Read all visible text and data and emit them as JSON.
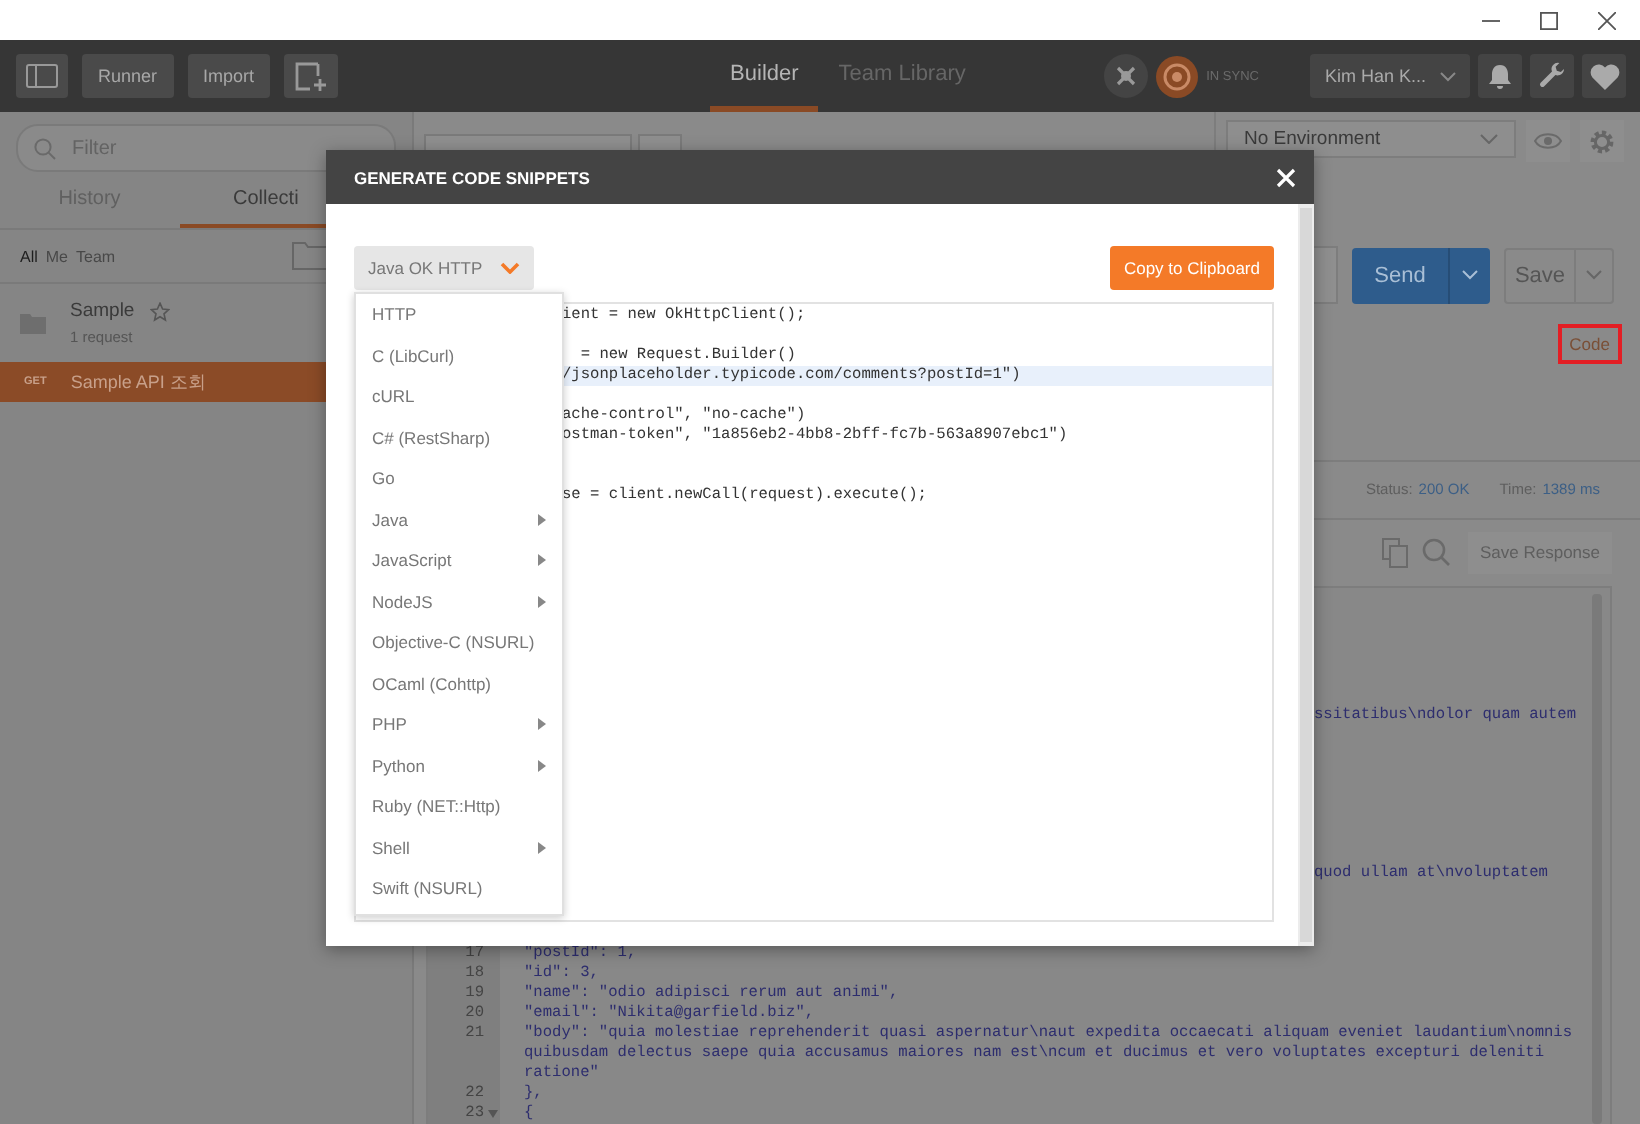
{
  "toolbar": {
    "buttons": [
      "Runner",
      "Import"
    ],
    "tabs": [
      {
        "label": "Builder",
        "selected": true
      },
      {
        "label": "Team Library",
        "selected": false
      }
    ],
    "sync_status": "IN SYNC",
    "user": "Kim Han K..."
  },
  "sidebar": {
    "search": {
      "placeholder": "Filter"
    },
    "tabs": [
      {
        "label": "History",
        "selected": false
      },
      {
        "label": "Collecti",
        "selected": true
      }
    ],
    "filters": [
      {
        "label": "All",
        "selected": true
      },
      {
        "label": "Me",
        "selected": false
      },
      {
        "label": "Team",
        "selected": false
      }
    ],
    "collections": [
      {
        "name": "Sample",
        "count": "1 request"
      }
    ],
    "requests": [
      {
        "method": "GET",
        "name": "Sample API 조회",
        "selected": true
      }
    ]
  },
  "environment": {
    "value": "No Environment"
  },
  "request": {
    "send": "Send",
    "save": "Save",
    "code_link": {
      "label": "Code",
      "highlighted": true
    }
  },
  "response": {
    "status_label": "Status:",
    "status": "200 OK",
    "time_label": "Time:",
    "time": "1389 ms",
    "save_button": "Save Response",
    "fragments": [
      "ssitatibus\\ndolor quam autem",
      "quod ullam at\\nvoluptatem"
    ],
    "lines": [
      {
        "number": "17",
        "text": "\"postId\": 1,",
        "foldable": false
      },
      {
        "number": "18",
        "text": "\"id\": 3,",
        "foldable": false
      },
      {
        "number": "19",
        "text": "\"name\": \"odio adipisci rerum aut animi\",",
        "foldable": false
      },
      {
        "number": "20",
        "text": "\"email\": \"Nikita@garfield.biz\",",
        "foldable": false
      },
      {
        "number": "21",
        "text": "\"body\": \"quia molestiae reprehenderit quasi aspernatur\\naut expedita occaecati aliquam eveniet laudantium\\nomnis quibusdam delectus saepe quia accusamus maiores nam est\\ncum et ducimus et vero voluptates excepturi deleniti ratione\"",
        "foldable": false
      },
      {
        "number": "22",
        "text": "},",
        "foldable": false
      },
      {
        "number": "23",
        "text": "{",
        "foldable": true
      }
    ]
  },
  "dialog": {
    "title": "GENERATE CODE SNIPPETS",
    "language": "Java OK HTTP",
    "copy_button": "Copy to Clipboard",
    "menu": [
      {
        "label": "HTTP",
        "submenu": false
      },
      {
        "label": "C (LibCurl)",
        "submenu": false
      },
      {
        "label": "cURL",
        "submenu": false
      },
      {
        "label": "C# (RestSharp)",
        "submenu": false
      },
      {
        "label": "Go",
        "submenu": false
      },
      {
        "label": "Java",
        "submenu": true
      },
      {
        "label": "JavaScript",
        "submenu": true
      },
      {
        "label": "NodeJS",
        "submenu": true
      },
      {
        "label": "Objective-C (NSURL)",
        "submenu": false
      },
      {
        "label": "OCaml (Cohttp)",
        "submenu": false
      },
      {
        "label": "PHP",
        "submenu": true
      },
      {
        "label": "Python",
        "submenu": true
      },
      {
        "label": "Ruby (NET::Http)",
        "submenu": false
      },
      {
        "label": "Shell",
        "submenu": true
      },
      {
        "label": "Swift (NSURL)",
        "submenu": false
      }
    ],
    "code": [
      {
        "kind": "text",
        "text": "ient = new OkHttpClient();",
        "highlighted": false
      },
      {
        "kind": "blank"
      },
      {
        "kind": "text",
        "text": "  = new Request.Builder()",
        "highlighted": false
      },
      {
        "kind": "text",
        "text": "/jsonplaceholder.typicode.com/comments?postId=1\")",
        "highlighted": true
      },
      {
        "kind": "blank"
      },
      {
        "kind": "text",
        "text": "ache-control\", \"no-cache\")",
        "highlighted": false
      },
      {
        "kind": "text",
        "text": "ostman-token\", \"1a856eb2-4bb8-2bff-fc7b-563a8907ebc1\")",
        "highlighted": false
      },
      {
        "kind": "blank"
      },
      {
        "kind": "blank"
      },
      {
        "kind": "text",
        "text": "se = client.newCall(request).execute();",
        "highlighted": false
      }
    ]
  }
}
